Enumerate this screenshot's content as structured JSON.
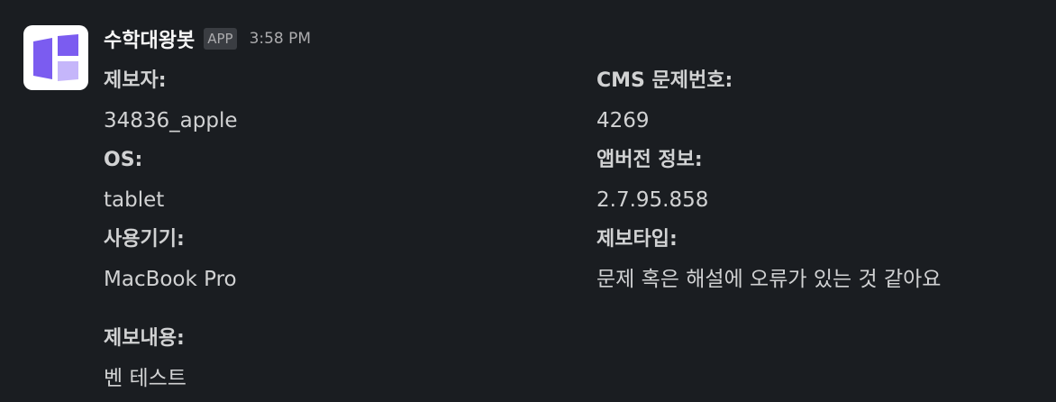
{
  "bot": {
    "name": "수학대왕봇",
    "badge": "APP",
    "time": "3:58 PM",
    "avatar_icon": "book-logo-icon",
    "avatar_colors": {
      "primary": "#7b5cf0",
      "light": "#c5b6fa",
      "background": "#ffffff"
    }
  },
  "fields": [
    {
      "label": "제보자:",
      "value": "34836_apple"
    },
    {
      "label": "CMS 문제번호:",
      "value": "4269"
    },
    {
      "label": "OS:",
      "value": "tablet"
    },
    {
      "label": "앱버전 정보:",
      "value": "2.7.95.858"
    },
    {
      "label": "사용기기:",
      "value": "MacBook Pro"
    },
    {
      "label": "제보타입:",
      "value": "문제 혹은 해설에 오류가 있는 것 같아요"
    }
  ],
  "report": {
    "label": "제보내용:",
    "value": "벤 테스트"
  }
}
